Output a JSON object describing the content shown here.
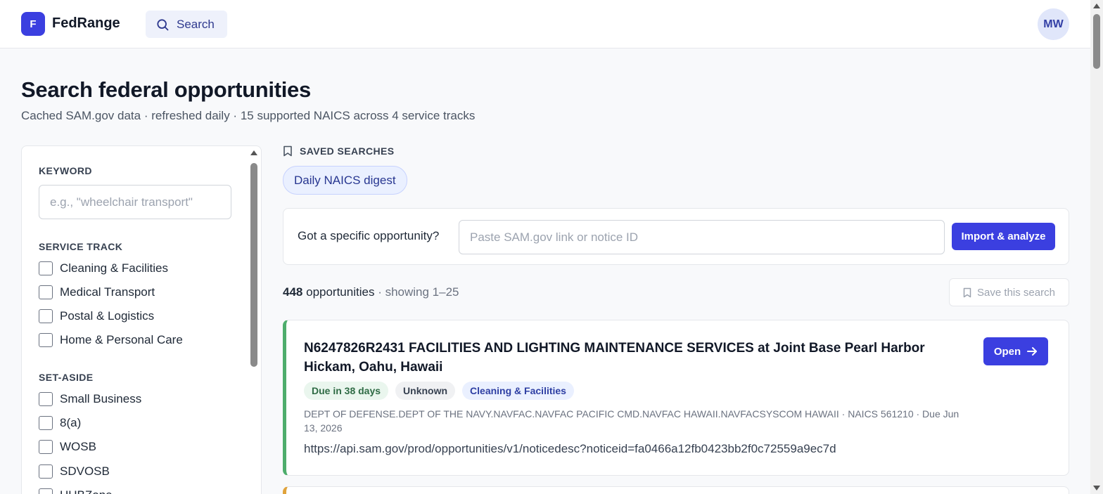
{
  "app": {
    "logo_letter": "F",
    "name": "FedRange",
    "search_label": "Search",
    "avatar_initials": "MW"
  },
  "header": {
    "title": "Search federal opportunities",
    "subtitle": "Cached SAM.gov data · refreshed daily · 15 supported NAICS across 4 service tracks"
  },
  "sidebar": {
    "keyword_label": "KEYWORD",
    "keyword_placeholder": "e.g., \"wheelchair transport\"",
    "service_track_label": "SERVICE TRACK",
    "service_tracks": [
      "Cleaning & Facilities",
      "Medical Transport",
      "Postal & Logistics",
      "Home & Personal Care"
    ],
    "set_aside_label": "SET-ASIDE",
    "set_asides": [
      "Small Business",
      "8(a)",
      "WOSB",
      "SDVOSB",
      "HUBZone"
    ]
  },
  "saved_searches": {
    "label": "SAVED SEARCHES",
    "items": [
      "Daily NAICS digest"
    ]
  },
  "import": {
    "label": "Got a specific opportunity?",
    "placeholder": "Paste SAM.gov link or notice ID",
    "button": "Import & analyze"
  },
  "results": {
    "count": "448",
    "count_suffix": "opportunities",
    "showing": "· showing 1–25",
    "save_label": "Save this search"
  },
  "opportunities": [
    {
      "title": "N6247826R2431 FACILITIES AND LIGHTING MAINTENANCE SERVICES at Joint Base Pearl Harbor Hickam, Oahu, Hawaii",
      "badges": [
        "Due in 38 days",
        "Unknown",
        "Cleaning & Facilities"
      ],
      "meta": "DEPT OF DEFENSE.DEPT OF THE NAVY.NAVFAC.NAVFAC PACIFIC CMD.NAVFAC HAWAII.NAVFACSYSCOM HAWAII · NAICS 561210 · Due Jun 13, 2026",
      "link": "https://api.sam.gov/prod/opportunities/v1/noticedesc?noticeid=fa0466a12fb0423bb2f0c72559a9ec7d",
      "open_label": "Open"
    }
  ],
  "colors": {
    "accent": "#3b3fe0",
    "due_stripe": "#4ead6c",
    "warn_stripe": "#e0a33b"
  }
}
